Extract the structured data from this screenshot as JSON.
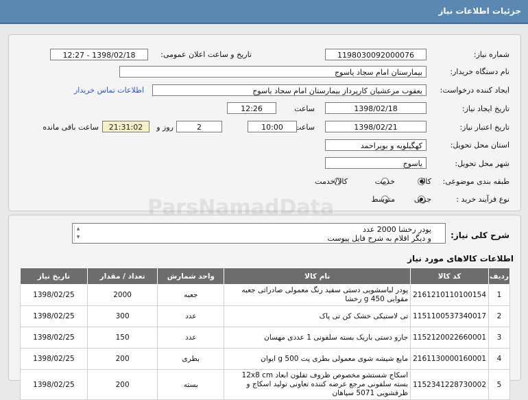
{
  "header": {
    "title": "جزئیات اطلاعات نیاز"
  },
  "form": {
    "need_number_label": "شماره نیاز:",
    "need_number": "1198030092000076",
    "announce_label": "تاریخ و ساعت اعلان عمومی:",
    "announce_value": "1398/02/18 - 12:27",
    "buyer_org_label": "نام دستگاه خریدار:",
    "buyer_org": "بیمارستان امام سجاد یاسوج",
    "requester_label": "ایجاد کننده درخواست:",
    "requester": "یعقوب مرعشیان کارپرداز بیمارستان امام سجاد یاسوج",
    "contact_link": "اطلاعات تماس خریدار",
    "created_label": "تاریخ ایجاد نیاز:",
    "created_date": "1398/02/18",
    "time_label": "ساعت",
    "created_time": "12:26",
    "validity_label": "تاریخ اعتبار نیاز:",
    "validity_date": "1398/02/21",
    "validity_time": "10:00",
    "days": "2",
    "days_label": "روز و",
    "remaining_time": "21:31:02",
    "remaining_label": "ساعت باقی مانده",
    "province_label": "استان محل تحویل:",
    "province": "کهگیلویه و بویراحمد",
    "city_label": "شهر محل تحویل:",
    "city": "یاسوج",
    "category_label": "طبقه بندی موضوعی:",
    "category_options": [
      "کالا",
      "خدمت",
      "کالا/خدمت"
    ],
    "category_selected": "کالا",
    "process_label": "نوع فرآیند خرید :",
    "process_options": [
      "جزیی",
      "متوسط"
    ],
    "process_selected": "جزیی"
  },
  "general": {
    "label": "شرح کلی نیاز:",
    "line1": "پودر رخشا 2000 عدد",
    "line2": "و دیگر اقلام به شرح فایل پیوست"
  },
  "items_section": {
    "title": "اطلاعات کالاهای مورد نیاز",
    "columns": [
      "ردیف",
      "کد کالا",
      "نام کالا",
      "واحد شمارش",
      "تعداد / مقدار",
      "تاریخ نیاز"
    ],
    "rows": [
      {
        "row": "1",
        "code": "2161210110100154",
        "name": "پودر لباسشویی دستی سفید رنگ معمولی صادراتی جعبه مقوایی 450 g رخشا",
        "unit": "جعبه",
        "qty": "2000",
        "date": "1398/02/25"
      },
      {
        "row": "2",
        "code": "1151100537340017",
        "name": "تی لاستیکی خشک کن تی پاک",
        "unit": "عدد",
        "qty": "300",
        "date": "1398/02/25"
      },
      {
        "row": "3",
        "code": "1152120022660001",
        "name": "جارو دستی باریک بسته سلفونی 1 عددی مهسان",
        "unit": "عدد",
        "qty": "150",
        "date": "1398/02/25"
      },
      {
        "row": "4",
        "code": "2161130000160001",
        "name": "مایع شیشه شوی معمولی بطری پت 500 g ایوان",
        "unit": "بطری",
        "qty": "200",
        "date": "1398/02/25"
      },
      {
        "row": "5",
        "code": "1152341228730002",
        "name": "اسکاج شستشو مخصوص ظروف تفلون ابعاد 12x8 cm بسته سلفونی مرجع عرضه کننده تعاونی تولید اسکاج و ظرفشویی 5071 سپاهان",
        "unit": "بسته",
        "qty": "200",
        "date": "1398/02/25"
      }
    ]
  },
  "watermark": {
    "text": "ParsNamadData"
  }
}
